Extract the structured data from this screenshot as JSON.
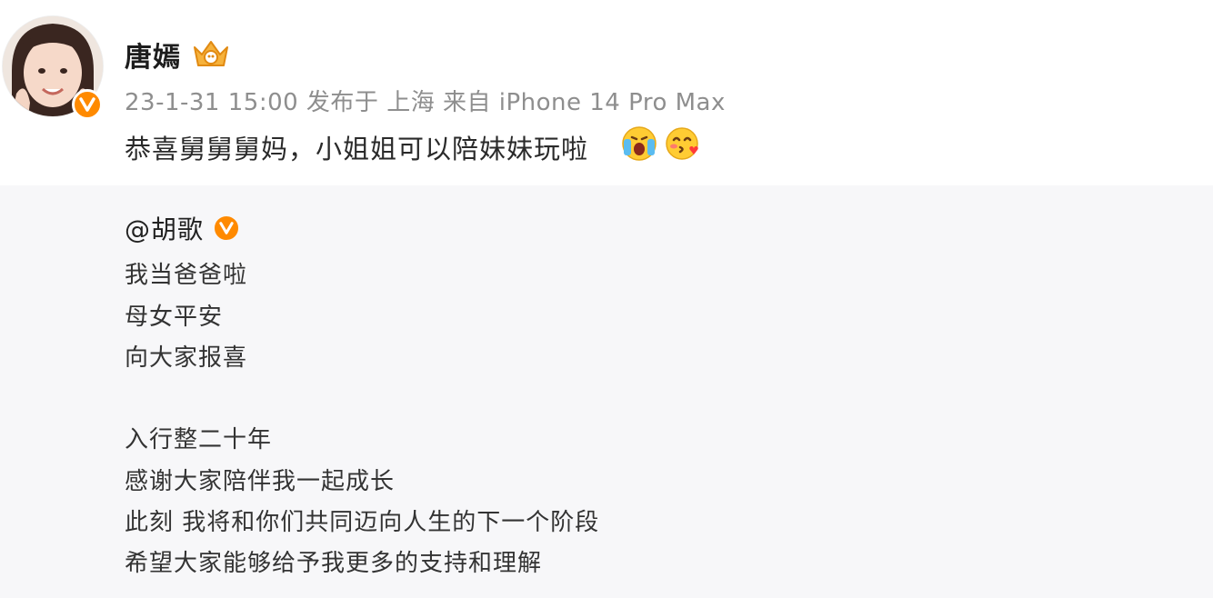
{
  "post": {
    "author": "唐嫣",
    "meta": "23-1-31 15:00 发布于 上海 来自 iPhone 14 Pro Max",
    "text": "恭喜舅舅舅妈，小姐姐可以陪妹妹玩啦",
    "emojis": [
      "crying-joy-emoji",
      "kiss-emoji"
    ],
    "badge_icon": "verified-v-icon",
    "member_icon": "vip-crown-icon"
  },
  "repost": {
    "mention": "@胡歌",
    "lines": [
      "我当爸爸啦",
      "母女平安",
      "向大家报喜",
      "",
      "入行整二十年",
      "感谢大家陪伴我一起成长",
      "此刻 我将和你们共同迈向人生的下一个阶段",
      "希望大家能够给予我更多的支持和理解"
    ]
  },
  "colors": {
    "verified": "#ff8a00",
    "meta_text": "#8e8e8e",
    "repost_bg": "#f7f7f9"
  }
}
